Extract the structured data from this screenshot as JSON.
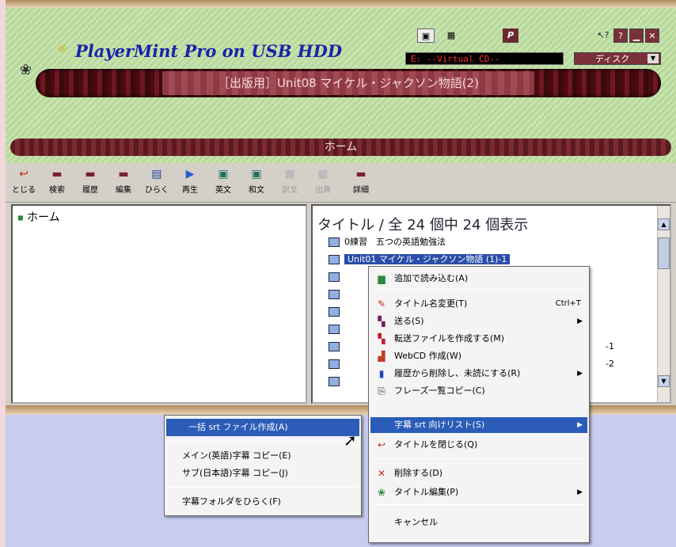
{
  "app": {
    "name": "PlayerMint Pro on USB HDD",
    "current_title": "［出版用］Unit08 マイケル・ジャクソン物語(2)",
    "drive": "E: --Virtual CD--",
    "disk_button": "ディスク",
    "section": "ホーム"
  },
  "icons": {
    "paw": "paw-icon",
    "bulb": "lightbulb-icon"
  },
  "toolbar": [
    {
      "label": "とじる",
      "icon": "close-icon"
    },
    {
      "label": "検索",
      "icon": "search-icon"
    },
    {
      "label": "履歴",
      "icon": "history-icon"
    },
    {
      "label": "編集",
      "icon": "edit-icon"
    },
    {
      "label": "ひらく",
      "icon": "open-book-icon"
    },
    {
      "label": "再生",
      "icon": "play-icon"
    },
    {
      "label": "英文",
      "icon": "english-icon"
    },
    {
      "label": "和文",
      "icon": "japanese-icon"
    },
    {
      "label": "訳文",
      "icon": "translation-icon"
    },
    {
      "label": "出典",
      "icon": "source-icon"
    },
    {
      "label": "詳細",
      "icon": "details-icon"
    }
  ],
  "tree": {
    "root": "ホーム"
  },
  "list": {
    "header": "タイトル / 全 24 個中 24 個表示",
    "rows": [
      "0練習　五つの英語勉強法",
      "Unit01 マイケル・ジャクソン物語 (1)-1",
      "",
      "",
      "",
      "",
      "-1",
      "-2",
      ""
    ]
  },
  "context_menu": {
    "items": [
      {
        "label": "追加で読み込む(A)",
        "icon": "folder-icon"
      },
      {
        "label": "タイトル名変更(T)",
        "shortcut": "Ctrl+T",
        "icon": "rename-icon"
      },
      {
        "label": "送る(S)",
        "icon": "send-icon",
        "submenu": true
      },
      {
        "label": "転送ファイルを作成する(M)",
        "icon": "transfer-icon"
      },
      {
        "label": "WebCD 作成(W)",
        "icon": "webcd-icon"
      },
      {
        "label": "履歴から削除し、未読にする(R)",
        "icon": "book-icon",
        "submenu": true
      },
      {
        "label": "フレーズ一覧コピー(C)",
        "icon": "copy-icon"
      },
      {
        "label": "字幕 srt 向けリスト(S)",
        "icon": "",
        "submenu": true
      },
      {
        "label": "タイトルを閉じる(Q)",
        "icon": "close-title-icon"
      },
      {
        "label": "削除する(D)",
        "icon": "delete-icon"
      },
      {
        "label": "タイトル編集(P)",
        "icon": "paw-icon",
        "submenu": true
      },
      {
        "label": "キャンセル",
        "icon": ""
      }
    ]
  },
  "submenu": {
    "items": [
      {
        "label": "一括 srt ファイル作成(A)"
      },
      {
        "label": "メイン(英語)字幕 コピー(E)"
      },
      {
        "label": "サブ(日本語)字幕 コピー(J)"
      },
      {
        "label": "字幕フォルダをひらく(F)"
      }
    ]
  }
}
